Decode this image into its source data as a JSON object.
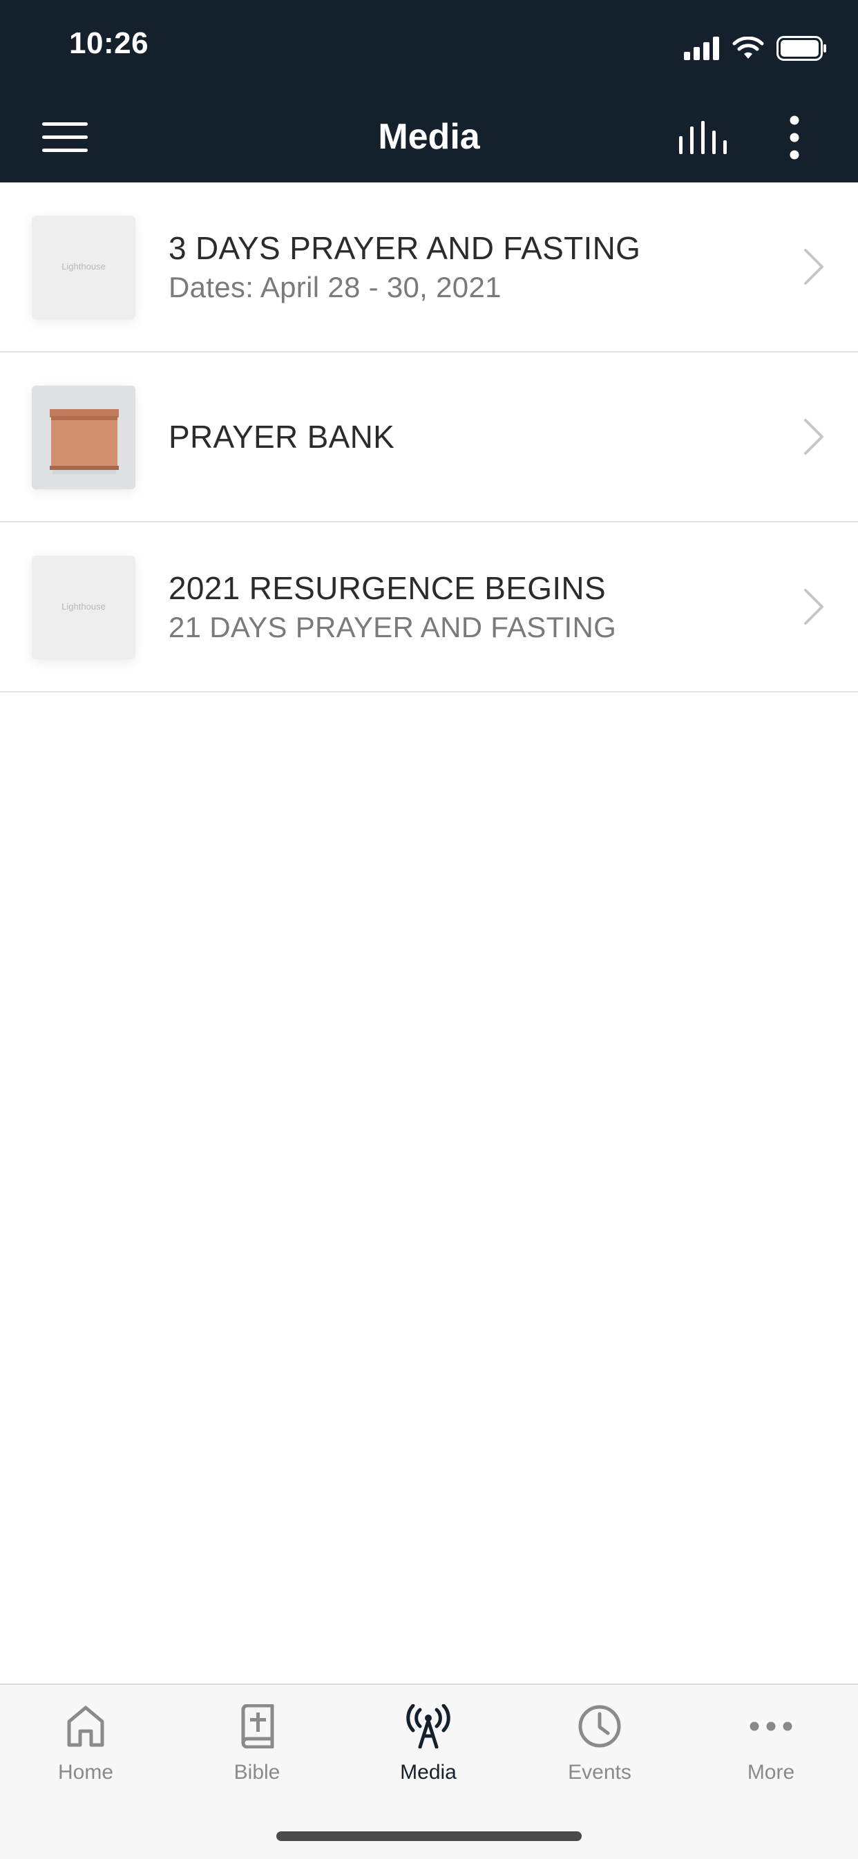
{
  "status_bar": {
    "time": "10:26"
  },
  "header": {
    "title": "Media",
    "menu_icon": "hamburger-menu-icon",
    "chart_icon": "equalizer-bars-icon",
    "more_icon": "vertical-ellipsis-icon"
  },
  "media_list": [
    {
      "title": "3 DAYS PRAYER AND FASTING",
      "subtitle": "Dates: April 28 - 30, 2021",
      "thumbnail": "Lighthouse"
    },
    {
      "title": "PRAYER BANK",
      "subtitle": "",
      "thumbnail": ""
    },
    {
      "title": "2021 RESURGENCE BEGINS",
      "subtitle": "21 DAYS PRAYER AND FASTING",
      "thumbnail": "Lighthouse"
    }
  ],
  "tabs": [
    {
      "label": "Home",
      "icon": "home-icon"
    },
    {
      "label": "Bible",
      "icon": "bible-icon"
    },
    {
      "label": "Media",
      "icon": "broadcast-icon",
      "active": true
    },
    {
      "label": "Events",
      "icon": "clock-icon"
    },
    {
      "label": "More",
      "icon": "horizontal-ellipsis-icon"
    }
  ],
  "colors": {
    "header_bg": "#14202b",
    "active_tab": "#14202b",
    "inactive_tab": "#8a8a8a"
  }
}
